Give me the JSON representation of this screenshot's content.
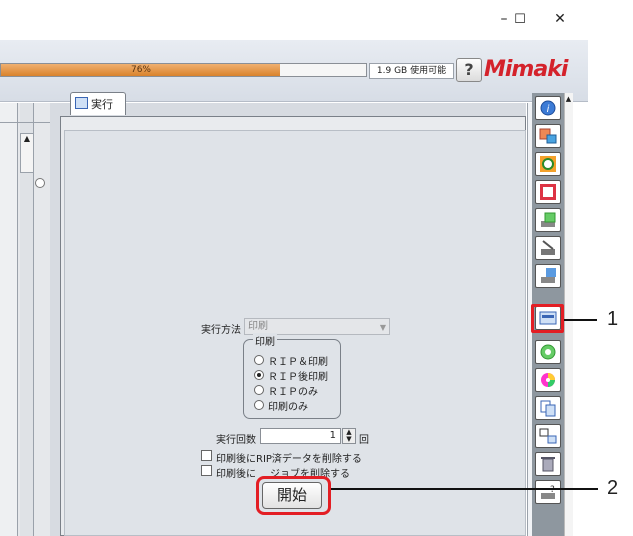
{
  "window": {
    "minimize_label": "–",
    "maximize_label": "☐",
    "close_label": "✕"
  },
  "header": {
    "progress_text": "76%",
    "progress_value": 0.76,
    "disk_free": "1.9 GB 使用可能",
    "help_label": "?",
    "logo_text": "Mimaki"
  },
  "tab": {
    "label": "実行"
  },
  "form": {
    "method_label": "実行方法",
    "method_value": "印刷",
    "group_title": "印刷",
    "options": [
      {
        "label": "ＲＩＰ＆印刷",
        "selected": false
      },
      {
        "label": "ＲＩＰ後印刷",
        "selected": true
      },
      {
        "label": "ＲＩＰのみ",
        "selected": false
      },
      {
        "label": "印刷のみ",
        "selected": false
      }
    ],
    "count_label": "実行回数",
    "count_value": "1",
    "count_unit": "回",
    "check1_label": "印刷後にRIP済データを削除する",
    "check2_label": "印刷後に",
    "check2_label_tail": "ジョブを削除する",
    "start_label": "開始"
  },
  "toolbar": {
    "tools": [
      "info-icon",
      "print-properties-icon",
      "quality-icon",
      "layout-icon",
      "layout-printer-icon",
      "cut-icon",
      "color-printer-icon",
      "execute-icon",
      "target-icon",
      "color-wheel-icon",
      "copy-icon",
      "split-icon",
      "trash-icon",
      "help-printer-icon"
    ]
  },
  "callouts": {
    "one": "1",
    "two": "2"
  },
  "colors": {
    "accent_red": "#e31e24",
    "progress_orange": "#d9822b",
    "logo_red": "#d4222b"
  }
}
